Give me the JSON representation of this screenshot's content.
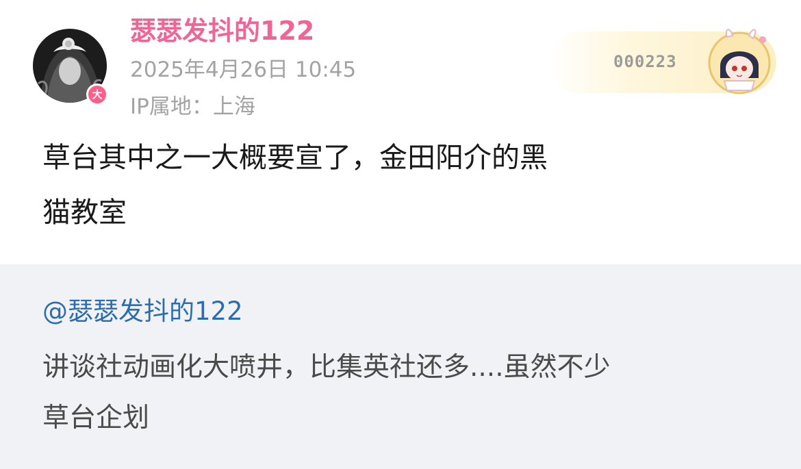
{
  "post": {
    "author": {
      "name": "瑟瑟发抖的122",
      "badge": "大",
      "timestamp": "2025年4月26日 10:45",
      "ip_location": "IP属地：上海"
    },
    "fan_card": {
      "number": "000223"
    },
    "text_line1": "草台其中之一大概要宣了，金田阳介的黑",
    "text_line2": "猫教室"
  },
  "repost": {
    "author": "@瑟瑟发抖的122",
    "text_line1": "讲谈社动画化大喷井，比集英社还多....虽然不少",
    "text_line2": "草台企划"
  },
  "colors": {
    "username": "#f06595",
    "meta_text": "#a3a3a3",
    "repost_author": "#2a6db0",
    "repost_bg": "#f1f2f5",
    "badge": "#ff5e8a"
  }
}
